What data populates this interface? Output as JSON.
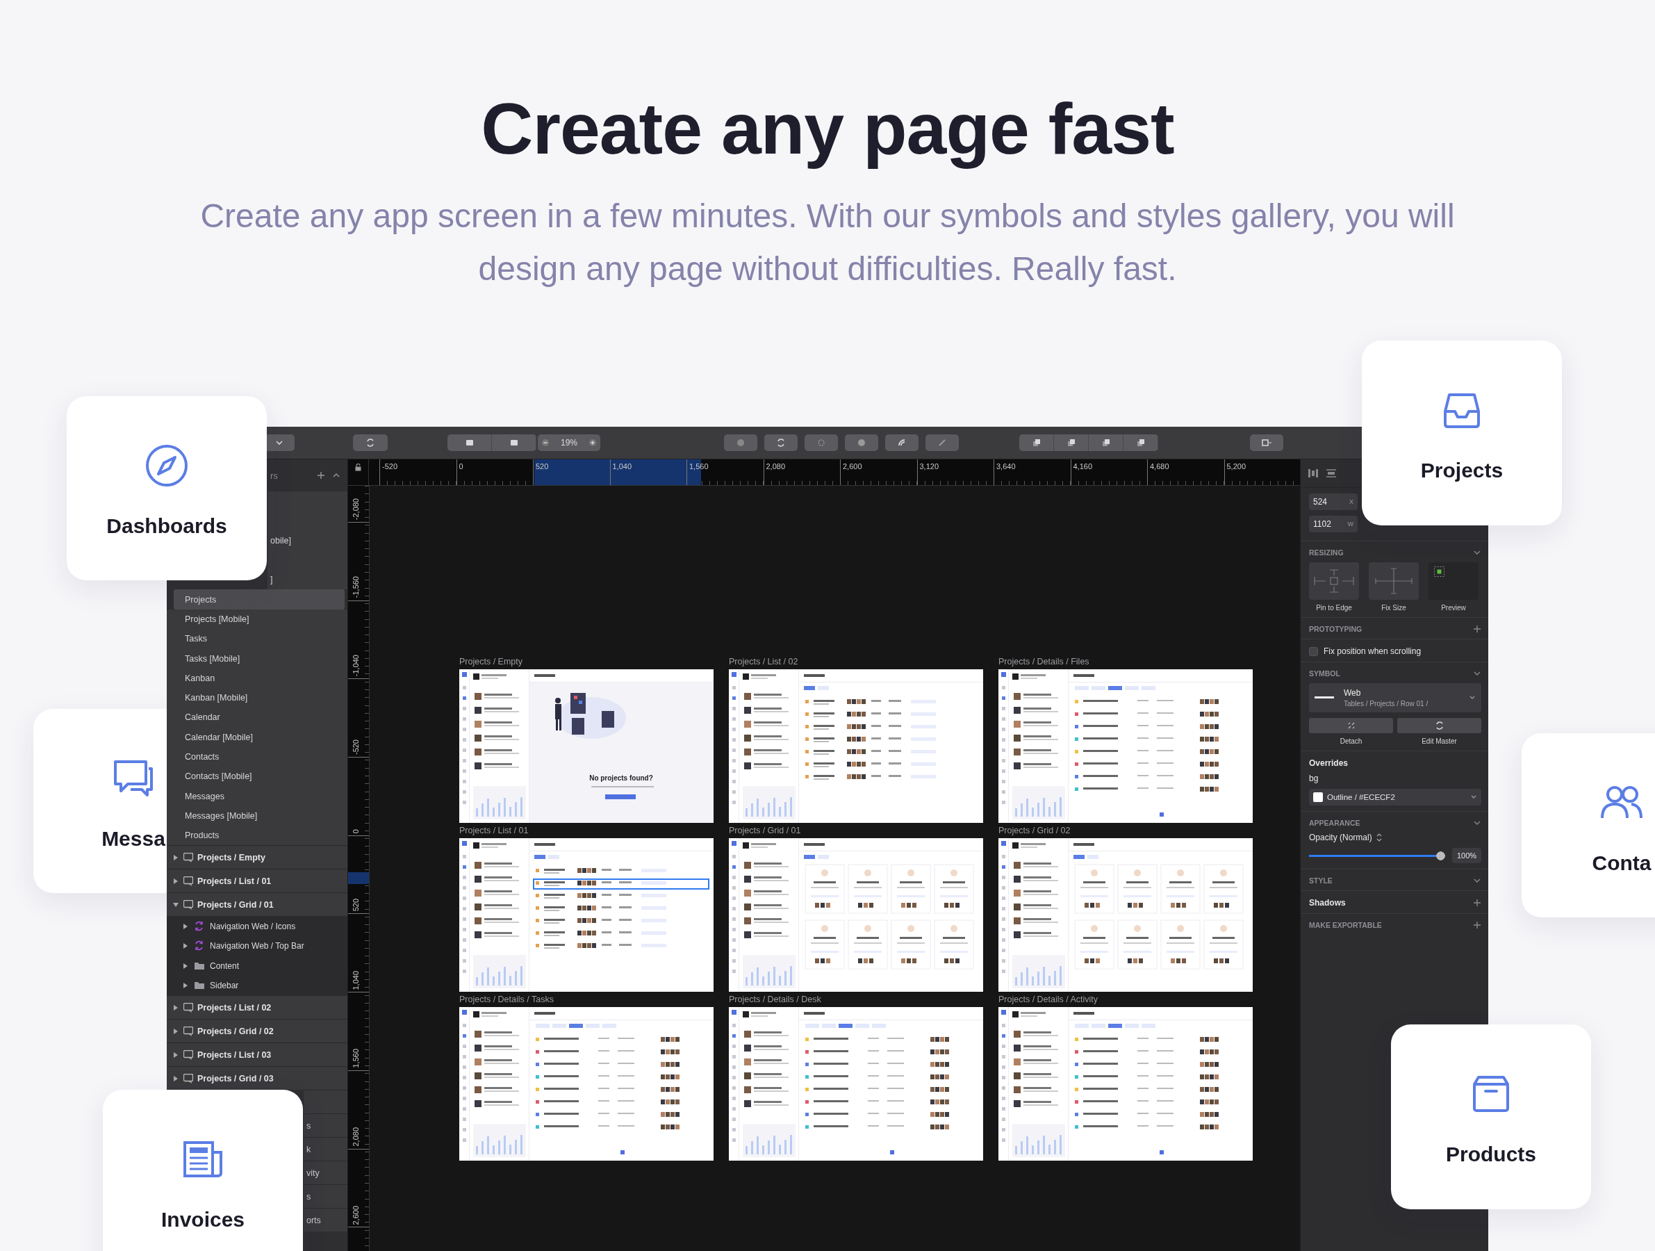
{
  "hero": {
    "title": "Create any page fast",
    "subtitle": "Create any app screen in a few minutes. With our symbols and styles gallery, you will design any page without difficulties. Really fast."
  },
  "feature_cards": [
    {
      "kind": "compass",
      "label": "Dashboards"
    },
    {
      "kind": "inbox",
      "label": "Projects"
    },
    {
      "kind": "chat",
      "label": "Messa"
    },
    {
      "kind": "people",
      "label": "Conta"
    },
    {
      "kind": "newspaper",
      "label": "Invoices"
    },
    {
      "kind": "box",
      "label": "Products"
    }
  ],
  "toolbar": {
    "zoom": "19%"
  },
  "rulers": {
    "horizontal": [
      "-520",
      "0",
      "520",
      "1,040",
      "1,560",
      "2,080",
      "2,600",
      "3,120",
      "3,640",
      "4,160",
      "4,680",
      "5,200"
    ],
    "vertical": [
      "-2,080",
      "-1,560",
      "-1,040",
      "-520",
      "0",
      "520",
      "1,040",
      "1,560",
      "2,080",
      "2,600"
    ]
  },
  "layers": {
    "header": "rs",
    "page_fragments": [
      "obile]",
      "]"
    ],
    "pages": [
      {
        "name": "Projects",
        "selected": true
      },
      {
        "name": "Projects [Mobile]",
        "selected": false
      },
      {
        "name": "Tasks",
        "selected": false
      },
      {
        "name": "Tasks [Mobile]",
        "selected": false
      },
      {
        "name": "Kanban",
        "selected": false
      },
      {
        "name": "Kanban [Mobile]",
        "selected": false
      },
      {
        "name": "Calendar",
        "selected": false
      },
      {
        "name": "Calendar [Mobile]",
        "selected": false
      },
      {
        "name": "Contacts",
        "selected": false
      },
      {
        "name": "Contacts [Mobile]",
        "selected": false
      },
      {
        "name": "Messages",
        "selected": false
      },
      {
        "name": "Messages [Mobile]",
        "selected": false
      },
      {
        "name": "Products",
        "selected": false
      }
    ],
    "artboards": [
      {
        "name": "Projects / Empty",
        "expanded": false
      },
      {
        "name": "Projects / List / 01",
        "expanded": false
      },
      {
        "name": "Projects / Grid / 01",
        "expanded": true,
        "children": [
          {
            "kind": "symbol",
            "name": "Navigation Web / Icons"
          },
          {
            "kind": "symbol",
            "name": "Navigation Web / Top Bar"
          },
          {
            "kind": "folder",
            "name": "Content"
          },
          {
            "kind": "folder",
            "name": "Sidebar"
          }
        ]
      },
      {
        "name": "Projects / List / 02",
        "expanded": false
      },
      {
        "name": "Projects / Grid / 02",
        "expanded": false
      },
      {
        "name": "Projects / List / 03",
        "expanded": false
      },
      {
        "name": "Projects / Grid / 03",
        "expanded": false
      }
    ],
    "artboard_fragments": [
      "s",
      "k",
      "vity",
      "s",
      "orts"
    ]
  },
  "canvas": {
    "artboards": [
      {
        "name": "Projects / Empty",
        "kind": "empty",
        "message": "No projects found?",
        "selection": false
      },
      {
        "name": "Projects / List / 02",
        "kind": "list",
        "selection": false
      },
      {
        "name": "Projects / Details / Files",
        "kind": "details",
        "selection": false
      },
      {
        "name": "Projects / List / 01",
        "kind": "list",
        "selection": true
      },
      {
        "name": "Projects / Grid / 01",
        "kind": "grid",
        "selection": false
      },
      {
        "name": "Projects / Grid / 02",
        "kind": "grid",
        "selection": false
      },
      {
        "name": "Projects / Details / Tasks",
        "kind": "details",
        "selection": false
      },
      {
        "name": "Projects / Details / Desk",
        "kind": "details",
        "selection": false
      },
      {
        "name": "Projects / Details / Activity",
        "kind": "details",
        "selection": false
      }
    ]
  },
  "inspector": {
    "fields": [
      {
        "value": "524",
        "unit": "X"
      },
      {
        "value": "1102",
        "unit": "W"
      }
    ],
    "resizing": {
      "title": "RESIZING",
      "options": [
        "Pin to Edge",
        "Fix Size",
        "Preview"
      ]
    },
    "prototyping": {
      "title": "PROTOTYPING",
      "option": {
        "label": "Fix position when scrolling",
        "checked": false
      }
    },
    "symbol": {
      "title": "SYMBOL",
      "name": "Web",
      "path": "Tables / Projects / Row 01 /",
      "actions": [
        "Detach",
        "Edit Master"
      ]
    },
    "overrides": {
      "title": "Overrides",
      "field": "bg",
      "value": "Outline / #ECECF2"
    },
    "appearance": {
      "title": "APPEARANCE",
      "label": "Opacity (Normal)",
      "level": 1,
      "reading": "100%"
    },
    "style": {
      "title": "STYLE"
    },
    "shadows": {
      "title": "Shadows"
    },
    "export": {
      "title": "MAKE EXPORTABLE"
    }
  }
}
